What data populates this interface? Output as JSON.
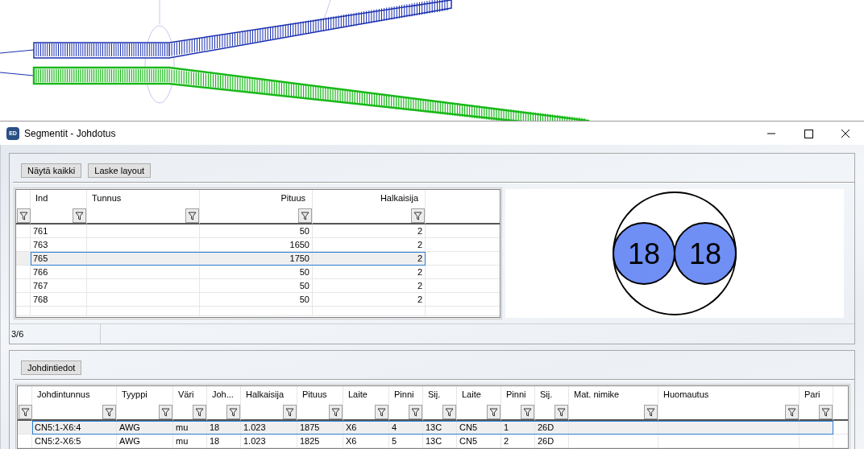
{
  "window": {
    "app_icon": "ED",
    "title": "Segmentit - Johdotus"
  },
  "segments_panel": {
    "buttons": [
      "Näytä kaikki",
      "Laske layout"
    ],
    "table": {
      "columns": [
        {
          "label": "Ind",
          "kind": "text"
        },
        {
          "label": "Tunnus",
          "kind": "text"
        },
        {
          "label": "Pituus",
          "kind": "number"
        },
        {
          "label": "Halkaisija",
          "kind": "number"
        }
      ],
      "rows": [
        {
          "cells": [
            "761",
            "",
            "50",
            "2"
          ],
          "selected": false
        },
        {
          "cells": [
            "763",
            "",
            "1650",
            "2"
          ],
          "selected": false
        },
        {
          "cells": [
            "765",
            "",
            "1750",
            "2"
          ],
          "selected": true
        },
        {
          "cells": [
            "766",
            "",
            "50",
            "2"
          ],
          "selected": false
        },
        {
          "cells": [
            "767",
            "",
            "50",
            "2"
          ],
          "selected": false
        },
        {
          "cells": [
            "768",
            "",
            "50",
            "2"
          ],
          "selected": false
        }
      ]
    },
    "cross_section": {
      "wires": [
        {
          "label": "18"
        },
        {
          "label": "18"
        }
      ]
    },
    "status_bar": "3/6"
  },
  "wires_panel": {
    "buttons": [
      "Johdintiedot"
    ],
    "table": {
      "columns": [
        {
          "label": "Johdintunnus"
        },
        {
          "label": "Tyyppi"
        },
        {
          "label": "Väri"
        },
        {
          "label": "Joh..."
        },
        {
          "label": "Halkaisija"
        },
        {
          "label": "Pituus"
        },
        {
          "label": "Laite"
        },
        {
          "label": "Pinni"
        },
        {
          "label": "Sij."
        },
        {
          "label": "Laite"
        },
        {
          "label": "Pinni"
        },
        {
          "label": "Sij."
        },
        {
          "label": "Mat. nimike"
        },
        {
          "label": "Huomautus"
        },
        {
          "label": "Pari"
        }
      ],
      "rows": [
        {
          "cells": [
            "CN5:1-X6:4",
            "AWG",
            "mu",
            "18",
            "1.023",
            "1875",
            "X6",
            "4",
            "13C",
            "CN5",
            "1",
            "26D",
            "",
            "",
            ""
          ],
          "selected": true
        },
        {
          "cells": [
            "CN5:2-X6:5",
            "AWG",
            "mu",
            "18",
            "1.023",
            "1825",
            "X6",
            "5",
            "13C",
            "CN5",
            "2",
            "26D",
            "",
            "",
            ""
          ],
          "selected": false
        }
      ]
    }
  }
}
